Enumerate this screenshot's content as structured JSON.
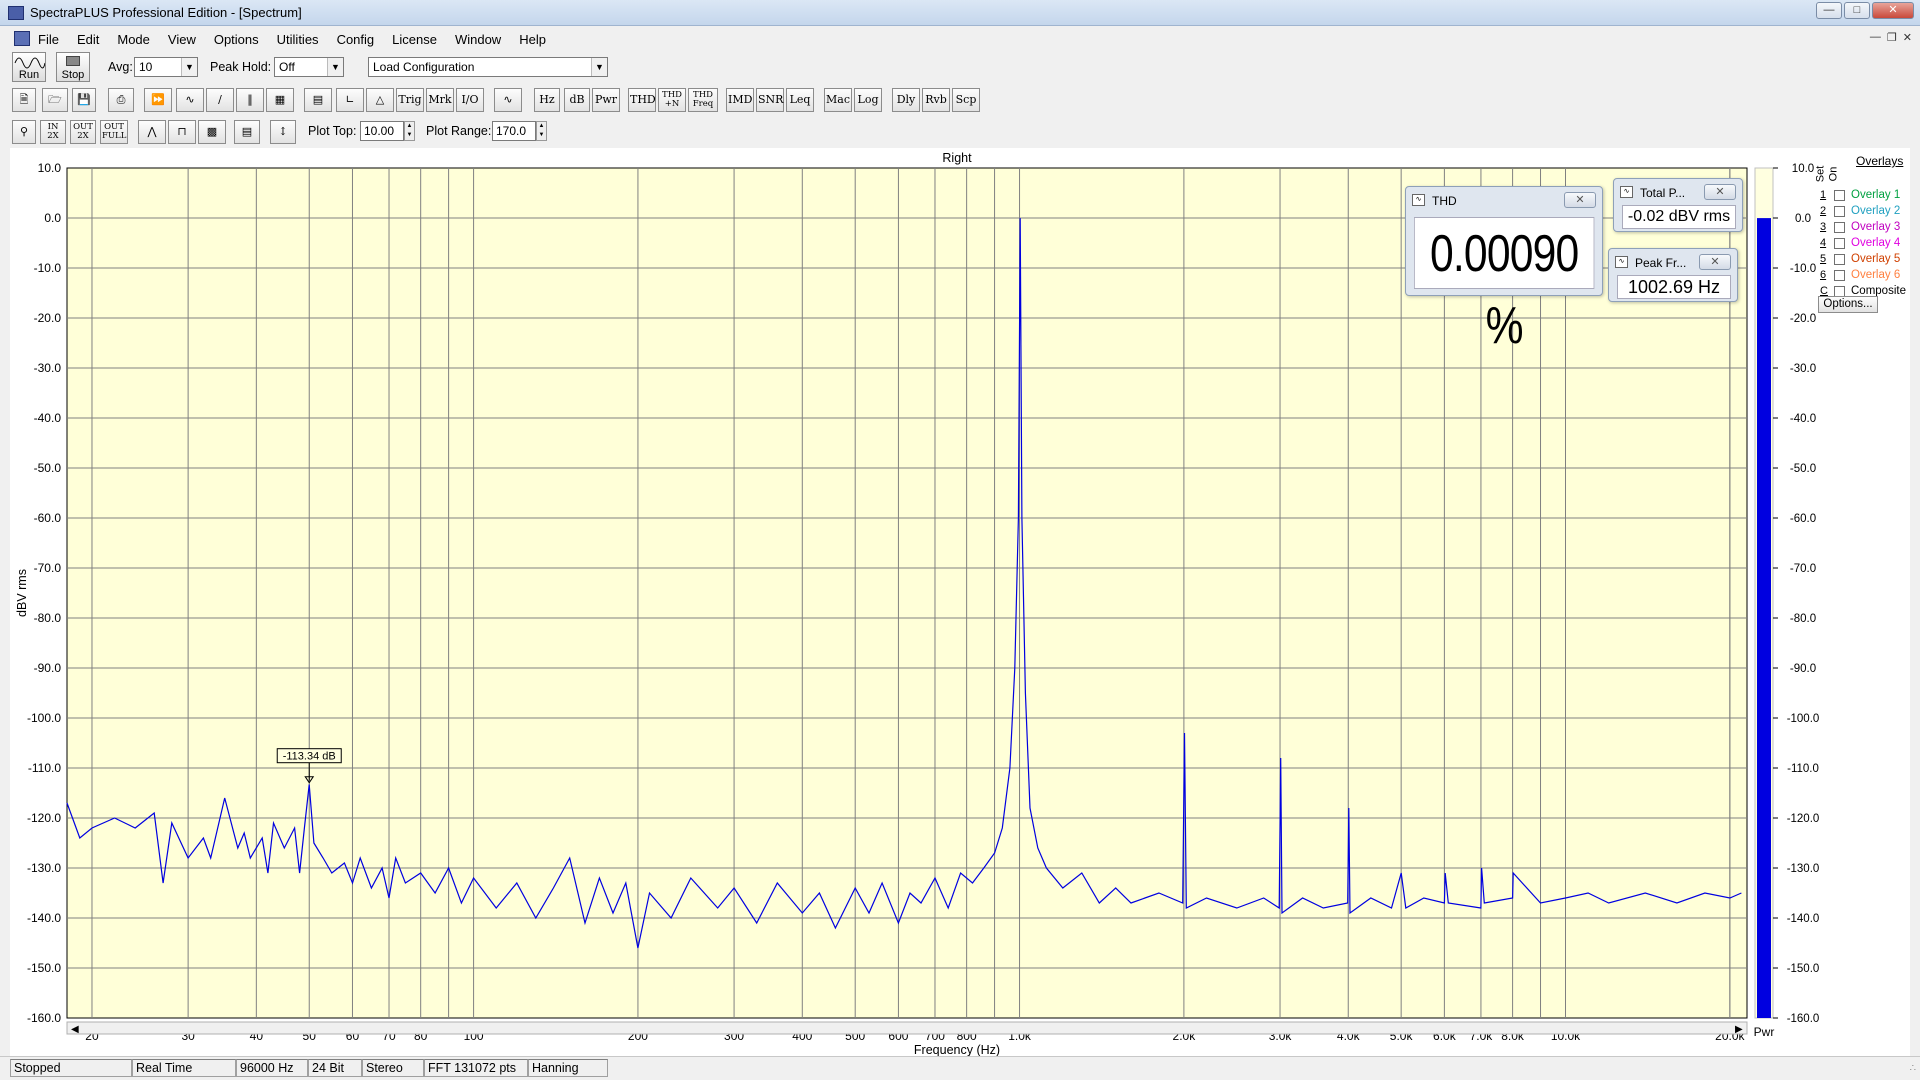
{
  "window": {
    "title": "SpectraPLUS Professional Edition - [Spectrum]"
  },
  "menu": [
    "File",
    "Edit",
    "Mode",
    "View",
    "Options",
    "Utilities",
    "Config",
    "License",
    "Window",
    "Help"
  ],
  "toolbar": {
    "run_label": "Run",
    "stop_label": "Stop",
    "avg_label": "Avg:",
    "avg_value": "10",
    "peak_hold_label": "Peak Hold:",
    "peak_hold_value": "Off",
    "config_value": "Load Configuration",
    "buttons": [
      "Hz",
      "dB",
      "Pwr",
      "THD",
      "THD+N",
      "THD Freq",
      "IMD",
      "SNR",
      "Leq",
      "Mac",
      "Log",
      "Dly",
      "Rvb",
      "Scp",
      "Trig",
      "Mrk",
      "I/O"
    ],
    "plot_top_label": "Plot Top:",
    "plot_top_value": "10.00",
    "plot_range_label": "Plot Range:",
    "plot_range_value": "170.0"
  },
  "meters": {
    "thd": {
      "title": "THD",
      "value": "0.00090 %"
    },
    "total_power": {
      "title": "Total P...",
      "value": "-0.02 dBV rms"
    },
    "peak_freq": {
      "title": "Peak Fr...",
      "value": "1002.69 Hz"
    }
  },
  "overlays": {
    "title": "Overlays",
    "set_label": "Set",
    "on_label": "On",
    "items": [
      {
        "key": "1",
        "label": "Overlay 1",
        "color": "#00a040"
      },
      {
        "key": "2",
        "label": "Overlay 2",
        "color": "#20a0c0"
      },
      {
        "key": "3",
        "label": "Overlay 3",
        "color": "#c000c0"
      },
      {
        "key": "4",
        "label": "Overlay 4",
        "color": "#e000e0"
      },
      {
        "key": "5",
        "label": "Overlay 5",
        "color": "#d04000"
      },
      {
        "key": "6",
        "label": "Overlay 6",
        "color": "#ff8040"
      },
      {
        "key": "C",
        "label": "Composite",
        "color": "#000000"
      }
    ],
    "options_label": "Options..."
  },
  "status": {
    "state": "Stopped",
    "mode": "Real Time",
    "rate": "96000 Hz",
    "bits": "24 Bit",
    "channels": "Stereo",
    "fft": "FFT 131072 pts",
    "window": "Hanning"
  },
  "chart_data": {
    "type": "line",
    "title": "Right",
    "xlabel": "Frequency (Hz)",
    "ylabel": "dBV rms",
    "x_scale": "log",
    "xlim": [
      18,
      21500
    ],
    "ylim": [
      -160,
      10
    ],
    "grid": true,
    "background": "#ffffd8",
    "line_color": "#0000e0",
    "y_ticks": [
      "10.0",
      "0.0",
      "-10.0",
      "-20.0",
      "-30.0",
      "-40.0",
      "-50.0",
      "-60.0",
      "-70.0",
      "-80.0",
      "-90.0",
      "-100.0",
      "-110.0",
      "-120.0",
      "-130.0",
      "-140.0",
      "-150.0",
      "-160.0"
    ],
    "x_tick_labels": [
      {
        "value": 20,
        "label": "20"
      },
      {
        "value": 30,
        "label": "30"
      },
      {
        "value": 40,
        "label": "40"
      },
      {
        "value": 50,
        "label": "50"
      },
      {
        "value": 60,
        "label": "60"
      },
      {
        "value": 70,
        "label": "70"
      },
      {
        "value": 80,
        "label": "80"
      },
      {
        "value": 100,
        "label": "100"
      },
      {
        "value": 200,
        "label": "200"
      },
      {
        "value": 300,
        "label": "300"
      },
      {
        "value": 400,
        "label": "400"
      },
      {
        "value": 500,
        "label": "500"
      },
      {
        "value": 600,
        "label": "600"
      },
      {
        "value": 700,
        "label": "700"
      },
      {
        "value": 800,
        "label": "800"
      },
      {
        "value": 1000,
        "label": "1.0k"
      },
      {
        "value": 2000,
        "label": "2.0k"
      },
      {
        "value": 3000,
        "label": "3.0k"
      },
      {
        "value": 4000,
        "label": "4.0k"
      },
      {
        "value": 5000,
        "label": "5.0k"
      },
      {
        "value": 6000,
        "label": "6.0k"
      },
      {
        "value": 7000,
        "label": "7.0k"
      },
      {
        "value": 8000,
        "label": "8.0k"
      },
      {
        "value": 10000,
        "label": "10.0k"
      },
      {
        "value": 20000,
        "label": "20.0k"
      }
    ],
    "series": [
      {
        "points": [
          [
            18,
            -117
          ],
          [
            19,
            -124
          ],
          [
            20,
            -122
          ],
          [
            22,
            -120
          ],
          [
            24,
            -122
          ],
          [
            26,
            -119
          ],
          [
            27,
            -133
          ],
          [
            28,
            -121
          ],
          [
            30,
            -128
          ],
          [
            32,
            -124
          ],
          [
            33,
            -128
          ],
          [
            35,
            -116
          ],
          [
            37,
            -126
          ],
          [
            38,
            -123
          ],
          [
            39,
            -128
          ],
          [
            41,
            -124
          ],
          [
            42,
            -131
          ],
          [
            43,
            -121
          ],
          [
            45,
            -126
          ],
          [
            47,
            -122
          ],
          [
            48,
            -131
          ],
          [
            49,
            -122
          ],
          [
            50,
            -113.3
          ],
          [
            51,
            -125
          ],
          [
            53,
            -128
          ],
          [
            55,
            -131
          ],
          [
            58,
            -129
          ],
          [
            60,
            -133
          ],
          [
            62,
            -128
          ],
          [
            65,
            -134
          ],
          [
            68,
            -130
          ],
          [
            70,
            -136
          ],
          [
            72,
            -128
          ],
          [
            75,
            -133
          ],
          [
            80,
            -131
          ],
          [
            85,
            -135
          ],
          [
            90,
            -130
          ],
          [
            95,
            -137
          ],
          [
            100,
            -132
          ],
          [
            110,
            -138
          ],
          [
            120,
            -133
          ],
          [
            130,
            -140
          ],
          [
            140,
            -134
          ],
          [
            150,
            -128
          ],
          [
            160,
            -141
          ],
          [
            170,
            -132
          ],
          [
            180,
            -139
          ],
          [
            190,
            -133
          ],
          [
            200,
            -146
          ],
          [
            210,
            -135
          ],
          [
            230,
            -140
          ],
          [
            250,
            -132
          ],
          [
            280,
            -138
          ],
          [
            300,
            -134
          ],
          [
            330,
            -141
          ],
          [
            360,
            -133
          ],
          [
            400,
            -139
          ],
          [
            430,
            -135
          ],
          [
            460,
            -142
          ],
          [
            500,
            -134
          ],
          [
            530,
            -139
          ],
          [
            560,
            -133
          ],
          [
            600,
            -141
          ],
          [
            630,
            -135
          ],
          [
            660,
            -137
          ],
          [
            700,
            -132
          ],
          [
            740,
            -138
          ],
          [
            780,
            -131
          ],
          [
            820,
            -133
          ],
          [
            860,
            -130
          ],
          [
            900,
            -127
          ],
          [
            930,
            -122
          ],
          [
            960,
            -110
          ],
          [
            980,
            -90
          ],
          [
            995,
            -60
          ],
          [
            1002.69,
            -0.02
          ],
          [
            1010,
            -60
          ],
          [
            1025,
            -95
          ],
          [
            1045,
            -118
          ],
          [
            1080,
            -126
          ],
          [
            1120,
            -130
          ],
          [
            1200,
            -134
          ],
          [
            1300,
            -131
          ],
          [
            1400,
            -137
          ],
          [
            1500,
            -134
          ],
          [
            1600,
            -137
          ],
          [
            1800,
            -135
          ],
          [
            1990,
            -137
          ],
          [
            2005,
            -103
          ],
          [
            2020,
            -138
          ],
          [
            2200,
            -136
          ],
          [
            2500,
            -138
          ],
          [
            2800,
            -136
          ],
          [
            2990,
            -138
          ],
          [
            3008,
            -108
          ],
          [
            3025,
            -139
          ],
          [
            3300,
            -136
          ],
          [
            3600,
            -138
          ],
          [
            3990,
            -137
          ],
          [
            4010,
            -118
          ],
          [
            4030,
            -139
          ],
          [
            4400,
            -136
          ],
          [
            4800,
            -138
          ],
          [
            5000,
            -131
          ],
          [
            5100,
            -138
          ],
          [
            5500,
            -136
          ],
          [
            6000,
            -137
          ],
          [
            6020,
            -131
          ],
          [
            6100,
            -137
          ],
          [
            7000,
            -138
          ],
          [
            7020,
            -130
          ],
          [
            7100,
            -137
          ],
          [
            8000,
            -136
          ],
          [
            8020,
            -131
          ],
          [
            9000,
            -137
          ],
          [
            10000,
            -136
          ],
          [
            11000,
            -135
          ],
          [
            12000,
            -137
          ],
          [
            14000,
            -135
          ],
          [
            16000,
            -137
          ],
          [
            18000,
            -135
          ],
          [
            20000,
            -136
          ],
          [
            21000,
            -135
          ]
        ]
      }
    ],
    "marker": {
      "x": 50,
      "y": -113.34,
      "label": "-113.34 dB"
    },
    "power_meter": {
      "label": "Pwr",
      "value": -0.02,
      "scale_ticks": [
        "10.0",
        "0.0",
        "-10.0",
        "-20.0",
        "-30.0",
        "-40.0",
        "-50.0",
        "-60.0",
        "-70.0",
        "-80.0",
        "-90.0",
        "-100.0",
        "-110.0",
        "-120.0",
        "-130.0",
        "-140.0",
        "-150.0",
        "-160.0"
      ]
    }
  }
}
